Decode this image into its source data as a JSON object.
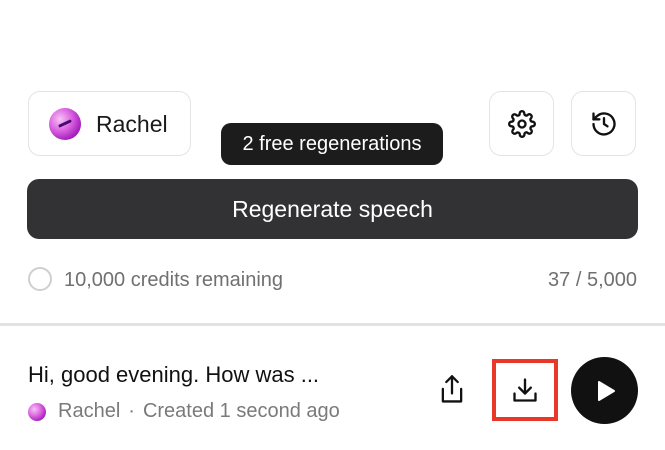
{
  "voice": {
    "name": "Rachel"
  },
  "toolbar": {
    "settings_icon": "gear-icon",
    "history_icon": "history-icon"
  },
  "tooltip": {
    "text": "2 free regenerations"
  },
  "regenerate": {
    "label": "Regenerate speech"
  },
  "status": {
    "credits": "10,000 credits remaining",
    "char_count": "37 / 5,000"
  },
  "history_item": {
    "title": "Hi, good evening. How was ...",
    "voice": "Rachel",
    "separator": "·",
    "created": "Created 1 second ago"
  },
  "colors": {
    "primary_button": "#323234",
    "play_button": "#111111",
    "highlight": "#e8382a"
  }
}
